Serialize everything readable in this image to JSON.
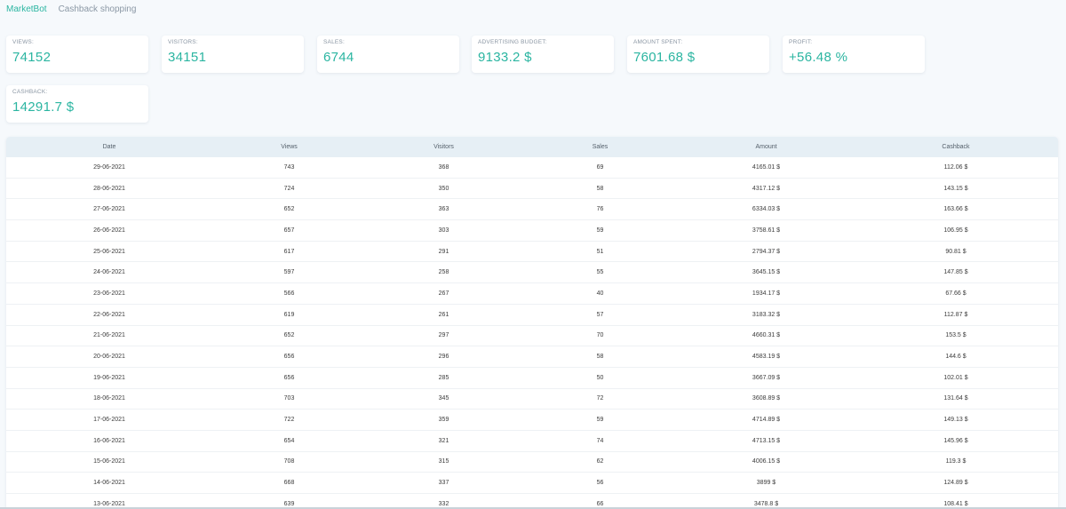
{
  "nav": {
    "brand": "MarketBot",
    "link": "Cashback shopping"
  },
  "stats": [
    {
      "label": "VIEWS:",
      "value": "74152"
    },
    {
      "label": "VISITORS:",
      "value": "34151"
    },
    {
      "label": "SALES:",
      "value": "6744"
    },
    {
      "label": "ADVERTISING BUDGET:",
      "value": "9133.2 $"
    },
    {
      "label": "AMOUNT SPENT:",
      "value": "7601.68 $"
    },
    {
      "label": "PROFIT:",
      "value": "+56.48 %"
    },
    {
      "label": "CASHBACK:",
      "value": "14291.7 $"
    }
  ],
  "table": {
    "headers": [
      "Date",
      "Views",
      "Visitors",
      "Sales",
      "Amount",
      "Cashback"
    ],
    "rows": [
      [
        "29-06-2021",
        "743",
        "368",
        "69",
        "4165.01 $",
        "112.06 $"
      ],
      [
        "28-06-2021",
        "724",
        "350",
        "58",
        "4317.12 $",
        "143.15 $"
      ],
      [
        "27-06-2021",
        "652",
        "363",
        "76",
        "6334.03 $",
        "163.66 $"
      ],
      [
        "26-06-2021",
        "657",
        "303",
        "59",
        "3758.61 $",
        "106.95 $"
      ],
      [
        "25-06-2021",
        "617",
        "291",
        "51",
        "2794.37 $",
        "90.81 $"
      ],
      [
        "24-06-2021",
        "597",
        "258",
        "55",
        "3645.15 $",
        "147.85 $"
      ],
      [
        "23-06-2021",
        "566",
        "267",
        "40",
        "1934.17 $",
        "67.66 $"
      ],
      [
        "22-06-2021",
        "619",
        "261",
        "57",
        "3183.32 $",
        "112.87 $"
      ],
      [
        "21-06-2021",
        "652",
        "297",
        "70",
        "4660.31 $",
        "153.5 $"
      ],
      [
        "20-06-2021",
        "656",
        "296",
        "58",
        "4583.19 $",
        "144.6 $"
      ],
      [
        "19-06-2021",
        "656",
        "285",
        "50",
        "3667.09 $",
        "102.01 $"
      ],
      [
        "18-06-2021",
        "703",
        "345",
        "72",
        "3608.89 $",
        "131.64 $"
      ],
      [
        "17-06-2021",
        "722",
        "359",
        "59",
        "4714.89 $",
        "149.13 $"
      ],
      [
        "16-06-2021",
        "654",
        "321",
        "74",
        "4713.15 $",
        "145.96 $"
      ],
      [
        "15-06-2021",
        "708",
        "315",
        "62",
        "4006.15 $",
        "119.3 $"
      ],
      [
        "14-06-2021",
        "668",
        "337",
        "56",
        "3899 $",
        "124.89 $"
      ],
      [
        "13-06-2021",
        "639",
        "332",
        "66",
        "3478.8 $",
        "108.41 $"
      ]
    ]
  }
}
